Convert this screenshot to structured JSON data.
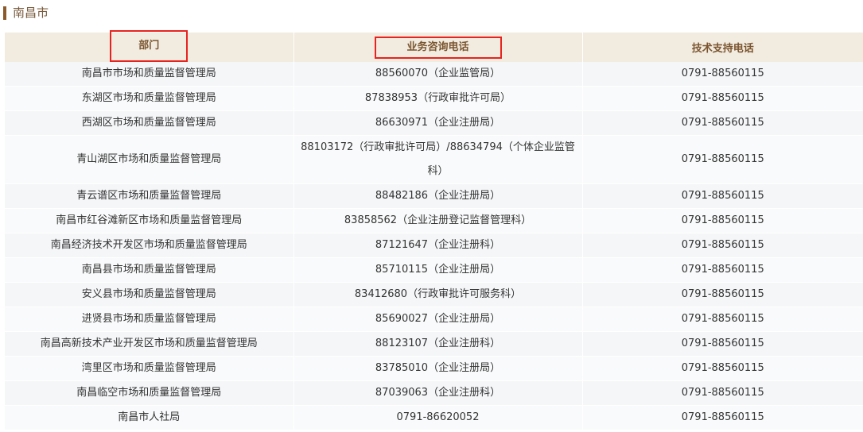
{
  "section": {
    "title": "南昌市"
  },
  "table": {
    "headers": [
      "部门",
      "业务咨询电话",
      "技术支持电话"
    ],
    "rows": [
      [
        "南昌市市场和质量监督管理局",
        "88560070（企业监管局）",
        "0791-88560115"
      ],
      [
        "东湖区市场和质量监督管理局",
        "87838953（行政审批许可局）",
        "0791-88560115"
      ],
      [
        "西湖区市场和质量监督管理局",
        "86630971（企业注册局）",
        "0791-88560115"
      ],
      [
        "青山湖区市场和质量监督管理局",
        "88103172（行政审批许可局）/88634794（个体企业监管科）",
        "0791-88560115"
      ],
      [
        "青云谱区市场和质量监督管理局",
        "88482186（企业注册局）",
        "0791-88560115"
      ],
      [
        "南昌市红谷滩新区市场和质量监督管理局",
        "83858562（企业注册登记监督管理科）",
        "0791-88560115"
      ],
      [
        "南昌经济技术开发区市场和质量监督管理局",
        "87121647（企业注册科）",
        "0791-88560115"
      ],
      [
        "南昌县市场和质量监督管理局",
        "85710115（企业注册局）",
        "0791-88560115"
      ],
      [
        "安义县市场和质量监督管理局",
        "83412680（行政审批许可服务科）",
        "0791-88560115"
      ],
      [
        "进贤县市场和质量监督管理局",
        "85690027（企业注册局）",
        "0791-88560115"
      ],
      [
        "南昌高新技术产业开发区市场和质量监督管理局",
        "88123107（企业注册科）",
        "0791-88560115"
      ],
      [
        "湾里区市场和质量监督管理局",
        "83785010（企业注册局）",
        "0791-88560115"
      ],
      [
        "南昌临空市场和质量监督管理局",
        "87039063（企业注册科）",
        "0791-88560115"
      ],
      [
        "南昌市人社局",
        "0791-86620052",
        "0791-88560115"
      ]
    ]
  },
  "colors": {
    "title_bar": "#8b5a2b",
    "header_bg": "#f2ebdf",
    "header_text": "#7a5530",
    "highlight_border": "#e8231f",
    "row_bg_odd": "#f4f6f8",
    "row_bg_even": "#f9fafb"
  }
}
